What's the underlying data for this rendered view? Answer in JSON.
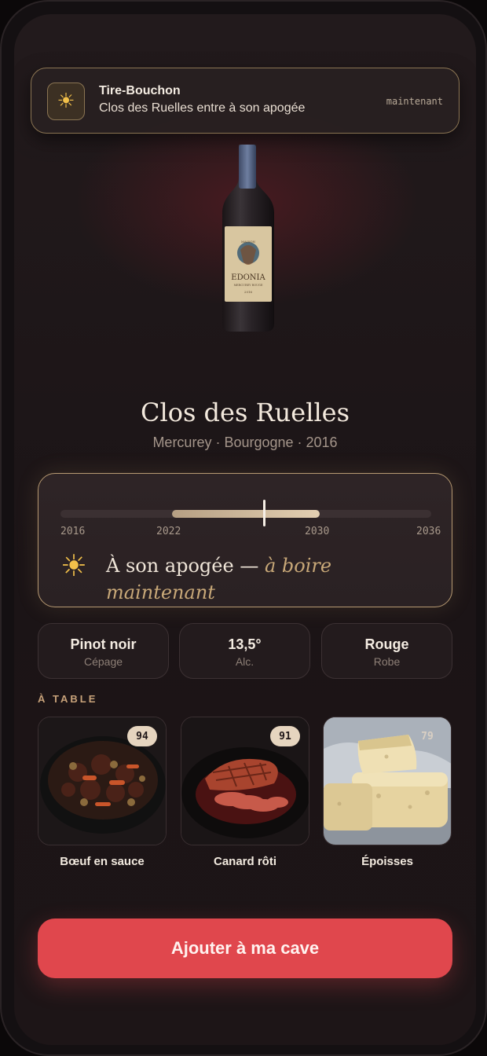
{
  "notification": {
    "app": "Tire-Bouchon",
    "message": "Clos des Ruelles entre à son apogée",
    "time": "maintenant",
    "icon": "sun-icon"
  },
  "wine": {
    "name": "Clos des Ruelles",
    "subtitle": "Mercurey · Bourgogne · 2016",
    "bottle_label": {
      "top": "MAISON",
      "name": "EDONIA",
      "line": "MERCUREY ROUGE",
      "year": "2016"
    }
  },
  "maturity": {
    "ticks": [
      "2016",
      "2022",
      "2030",
      "2036"
    ],
    "range_start": 2016,
    "range_end": 2036,
    "window_start": 2022,
    "window_end": 2030,
    "now": 2027,
    "icon": "sun-icon",
    "status": "À son apogée —",
    "advice": "à boire maintenant"
  },
  "stats": [
    {
      "value": "Pinot noir",
      "label": "Cépage"
    },
    {
      "value": "13,5°",
      "label": "Alc."
    },
    {
      "value": "Rouge",
      "label": "Robe"
    }
  ],
  "pairings_title": "À TABLE",
  "pairings": [
    {
      "name": "Bœuf en sauce",
      "score": "94"
    },
    {
      "name": "Canard rôti",
      "score": "91"
    },
    {
      "name": "Époisses",
      "score": "79"
    }
  ],
  "cta_label": "Ajouter à ma cave",
  "colors": {
    "accent": "#e0474d",
    "gold": "#c8a878",
    "sun": "#f2c04a"
  }
}
